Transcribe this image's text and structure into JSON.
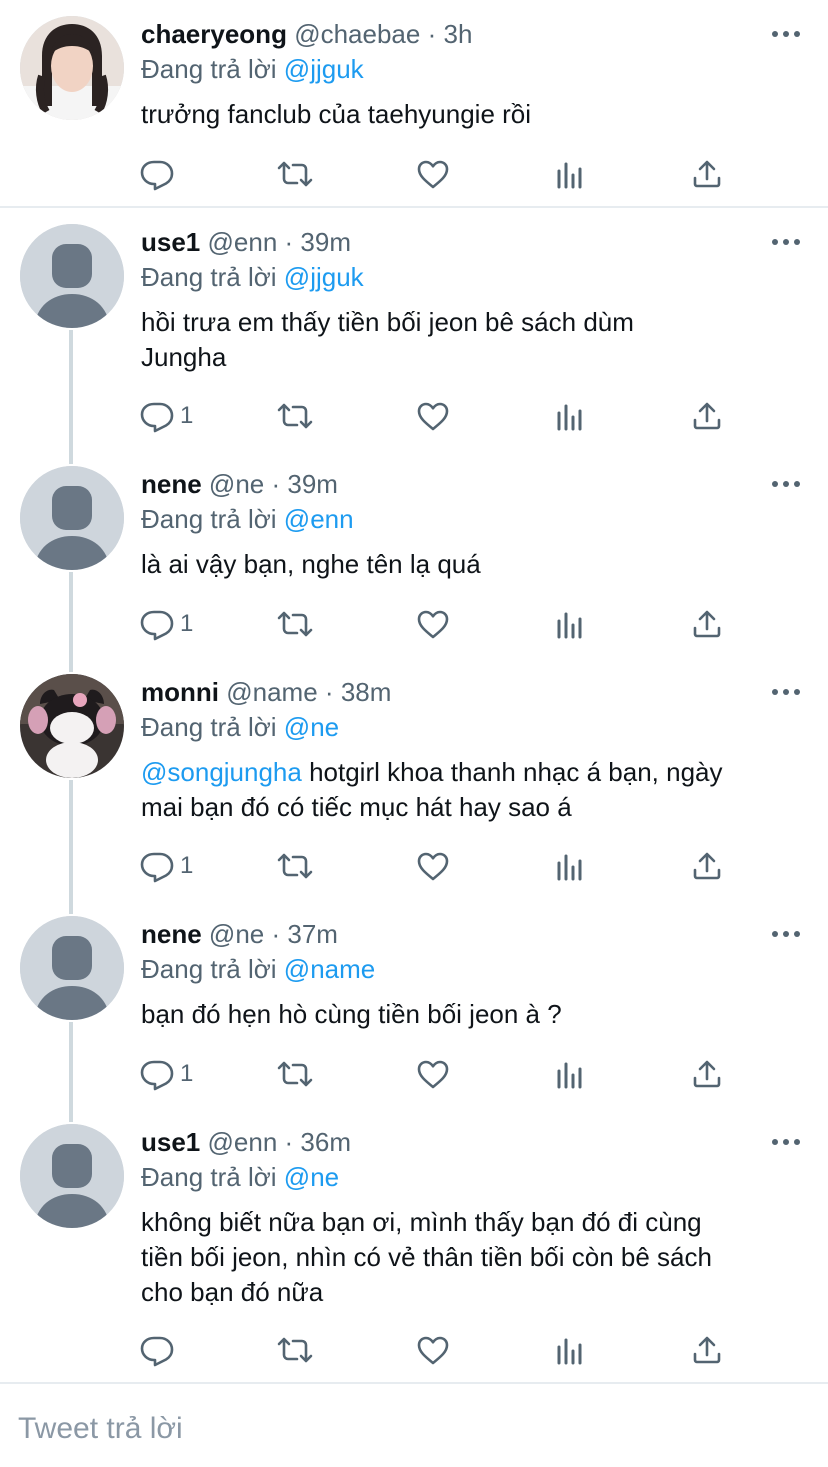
{
  "colors": {
    "link": "#1d9bf0",
    "secondary": "#536471",
    "avatar_placeholder": "#ced5dc",
    "thread_line": "#cfd9de"
  },
  "replying_prefix": "Đang trả lời",
  "tweets": [
    {
      "name": "chaeryeong",
      "handle": "@chaebae",
      "time": "3h",
      "reply_to": "@jjguk",
      "text": "trưởng fanclub của taehyungie rồi",
      "reply_count": "",
      "avatar": "photo-girl"
    },
    {
      "name": "use1",
      "handle": "@enn",
      "time": "39m",
      "reply_to": "@jjguk",
      "text_line1": "hồi trưa em thấy tiền bối jeon bê sách dùm",
      "text_line2": "Jungha",
      "reply_count": "1",
      "avatar": "default-avatar"
    },
    {
      "name": "nene",
      "handle": "@ne",
      "time": "39m",
      "reply_to": "@enn",
      "text": "là ai vậy bạn, nghe tên lạ quá",
      "reply_count": "1",
      "avatar": "default-avatar"
    },
    {
      "name": "monni",
      "handle": "@name",
      "time": "38m",
      "reply_to": "@ne",
      "mention": "@songjungha",
      "text_line1": " hotgirl khoa thanh nhạc á bạn, ngày",
      "text_line2": "mai bạn đó có tiếc mục hát hay sao á",
      "reply_count": "1",
      "avatar": "plush-toy-photo"
    },
    {
      "name": "nene",
      "handle": "@ne",
      "time": "37m",
      "reply_to": "@name",
      "text": "bạn đó hẹn hò cùng tiền bối jeon à ?",
      "reply_count": "1",
      "avatar": "default-avatar"
    },
    {
      "name": "use1",
      "handle": "@enn",
      "time": "36m",
      "reply_to": "@ne",
      "text_line1": "không biết nữa bạn ơi, mình thấy bạn đó đi cùng",
      "text_line2": "tiền bối jeon, nhìn có vẻ thân tiền bối còn bê sách",
      "text_line3": "cho bạn đó nữa",
      "reply_count": "",
      "avatar": "default-avatar"
    }
  ],
  "compose": {
    "placeholder": "Tweet trả lời"
  },
  "icons": [
    "reply-icon",
    "retweet-icon",
    "like-icon",
    "analytics-icon",
    "share-icon",
    "more-icon"
  ]
}
